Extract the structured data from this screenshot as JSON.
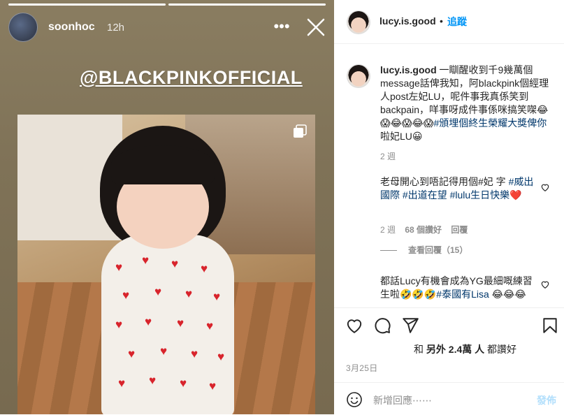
{
  "story": {
    "username": "soonhoc",
    "time": "12h",
    "mention": "@BLACKPINKOFFICIAL",
    "progress_segments": 2
  },
  "post": {
    "username": "lucy.is.good",
    "dot": "•",
    "follow_label": "追蹤",
    "caption_user": "lucy.is.good",
    "caption_text": " 一瞓醒收到千9幾萬個message話俾我知，阿blackpink個經理人post左妃LU，呢件事我真係笑到backpain，咩事呀成件事係咪搞笑㗎😂😱😂😱😂😱",
    "caption_tag": "#頒埋個終生榮耀大獎俾你",
    "caption_tail": "啦妃LU😀",
    "caption_age": "2 週",
    "comments": [
      {
        "text_start": "老母開心到唔記得用個#妃 字 ",
        "tags": "#威出國際 #出道在望 #lulu生日快樂",
        "text_end": "❤️",
        "age": "2 週",
        "likes": "68 個讚好",
        "reply": "回覆"
      },
      {
        "text_start": "都話Lucy有機會成為YG最細嘅練習生啦🤣🤣🤣",
        "tags": "#泰國有Lisa",
        "text_end": " 😂😂😂"
      }
    ],
    "view_replies": "查看回覆（15）",
    "likes_text_prefix": "和 ",
    "likes_text_count": "另外 2.4萬 人",
    "likes_text_suffix": " 都讚好",
    "date": "3月25日",
    "comment_placeholder": "新增回應⋯⋯",
    "post_button": "發佈"
  },
  "colors": {
    "accent": "#0095f6",
    "link": "#00376b",
    "muted": "#8e8e8e",
    "text": "#262626"
  }
}
